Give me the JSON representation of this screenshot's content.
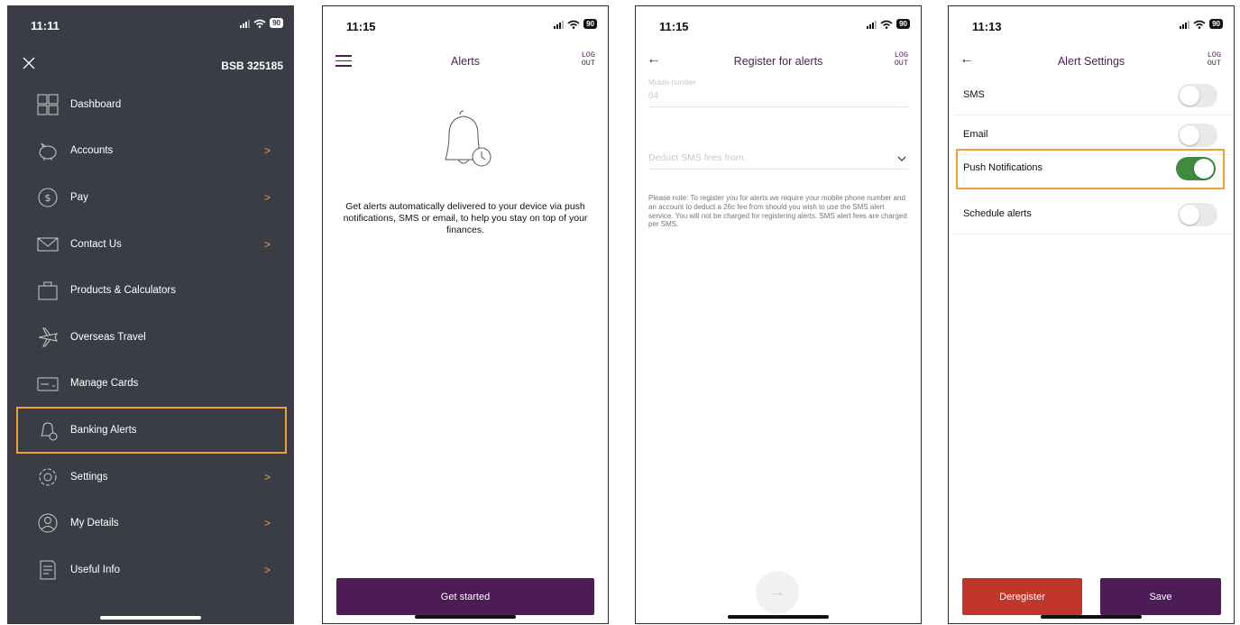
{
  "colors": {
    "accent": "#4d1b56",
    "menu_bg": "#3a3d45",
    "highlight": "#f0a030",
    "toggle_on": "#3f8a3f",
    "danger": "#c0362b",
    "chevron": "#e5a23a"
  },
  "menu_screen": {
    "time": "11:11",
    "battery": "90",
    "bsb": "BSB 325185",
    "items": [
      {
        "label": "Dashboard",
        "icon": "dashboard-icon",
        "chevron": false
      },
      {
        "label": "Accounts",
        "icon": "piggy-bank-icon",
        "chevron": true
      },
      {
        "label": "Pay",
        "icon": "dollar-icon",
        "chevron": true
      },
      {
        "label": "Contact Us",
        "icon": "envelope-icon",
        "chevron": true
      },
      {
        "label": "Products & Calculators",
        "icon": "bag-icon",
        "chevron": false
      },
      {
        "label": "Overseas Travel",
        "icon": "plane-icon",
        "chevron": false
      },
      {
        "label": "Manage Cards",
        "icon": "card-icon",
        "chevron": false
      },
      {
        "label": "Banking Alerts",
        "icon": "bell-icon",
        "chevron": false,
        "highlighted": true
      },
      {
        "label": "Settings",
        "icon": "gear-icon",
        "chevron": true
      },
      {
        "label": "My Details",
        "icon": "user-icon",
        "chevron": true
      },
      {
        "label": "Useful Info",
        "icon": "document-icon",
        "chevron": true
      }
    ],
    "chevron_glyph": ">"
  },
  "alerts_screen": {
    "time": "11:15",
    "battery": "90",
    "title": "Alerts",
    "logout": "LOG\nOUT",
    "description": "Get alerts automatically delivered to your device via push notifications, SMS or email, to help you stay on top of your finances.",
    "button": "Get started"
  },
  "register_screen": {
    "time": "11:15",
    "battery": "90",
    "title": "Register for alerts",
    "logout": "LOG\nOUT",
    "back": "←",
    "mobile_label": "Mobile number",
    "mobile_value": "04",
    "deduct_label": "Deduct SMS fees from:",
    "note": "Please note: To register you for alerts we require your mobile phone number and an account to deduct a 26c fee from should you wish to use the SMS alert service. You will not be charged for registering alerts. SMS alert fees are charged per SMS.",
    "next": "→"
  },
  "settings_screen": {
    "time": "11:13",
    "battery": "90",
    "title": "Alert Settings",
    "logout": "LOG\nOUT",
    "back": "←",
    "rows": [
      {
        "label": "SMS",
        "on": false
      },
      {
        "label": "Email",
        "on": false
      },
      {
        "label": "Push Notifications",
        "on": true,
        "highlighted": true
      },
      {
        "label": "Schedule alerts",
        "on": false
      }
    ],
    "deregister": "Deregister",
    "save": "Save"
  }
}
